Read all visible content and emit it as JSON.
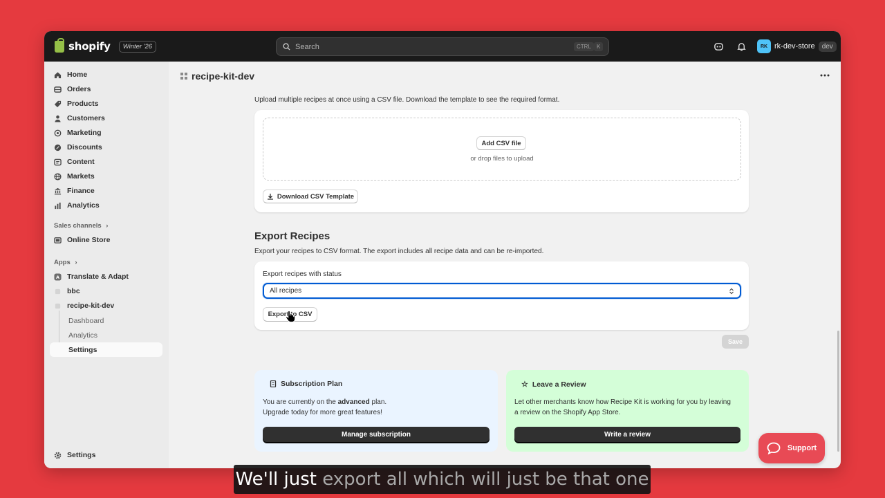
{
  "topbar": {
    "brand": "shopify",
    "edition": "Winter '26",
    "search_placeholder": "Search",
    "shortcut_keys": [
      "CTRL",
      "K"
    ],
    "store_initials": "RK",
    "store_name": "rk-dev-store",
    "store_env": "dev"
  },
  "sidebar": {
    "items": [
      {
        "label": "Home",
        "icon": "home-icon"
      },
      {
        "label": "Orders",
        "icon": "orders-icon"
      },
      {
        "label": "Products",
        "icon": "tag-icon"
      },
      {
        "label": "Customers",
        "icon": "person-icon"
      },
      {
        "label": "Marketing",
        "icon": "target-icon"
      },
      {
        "label": "Discounts",
        "icon": "discount-icon"
      },
      {
        "label": "Content",
        "icon": "content-icon"
      },
      {
        "label": "Markets",
        "icon": "globe-icon"
      },
      {
        "label": "Finance",
        "icon": "bank-icon"
      },
      {
        "label": "Analytics",
        "icon": "chart-icon"
      }
    ],
    "sales_channels_label": "Sales channels",
    "online_store": "Online Store",
    "apps_label": "Apps",
    "apps": [
      "Translate & Adapt",
      "bbc",
      "recipe-kit-dev"
    ],
    "app_subitems": [
      "Dashboard",
      "Analytics",
      "Settings"
    ],
    "settings": "Settings"
  },
  "page": {
    "title": "recipe-kit-dev"
  },
  "import": {
    "description": "Upload multiple recipes at once using a CSV file. Download the template to see the required format.",
    "add_file_button": "Add CSV file",
    "drop_hint": "or drop files to upload",
    "template_button": "Download CSV Template"
  },
  "export": {
    "heading": "Export Recipes",
    "description": "Export your recipes to CSV format. The export includes all recipe data and can be re-imported.",
    "status_label": "Export recipes with status",
    "status_value": "All recipes",
    "export_button": "Export to CSV"
  },
  "save_button": "Save",
  "subscription": {
    "title": "Subscription Plan",
    "text_prefix": "You are currently on the ",
    "plan": "advanced",
    "text_suffix": " plan.",
    "text_line2": "Upgrade today for more great features!",
    "button": "Manage subscription",
    "bg": "#eaf4ff"
  },
  "review": {
    "title": "Leave a Review",
    "text": "Let other merchants know how Recipe Kit is working for you by leaving a review on the Shopify App Store.",
    "button": "Write a review",
    "bg": "#d4fed8"
  },
  "support_button": "Support",
  "caption": {
    "spoken": "We'll just",
    "upcoming": "export all which will just be that one"
  }
}
